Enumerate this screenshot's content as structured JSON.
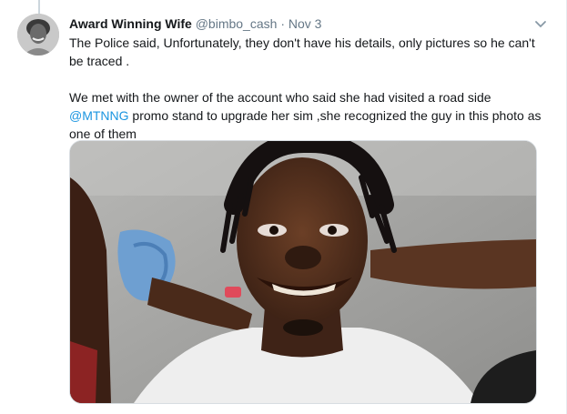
{
  "tweet": {
    "display_name": "Award Winning Wife",
    "handle": "@bimbo_cash",
    "separator": "·",
    "date": "Nov 3",
    "line1": "The Police said, Unfortunately, they don't have his details, only pictures so he can't be traced .",
    "line2_before": "We met with the owner of the account who said she had visited a road side ",
    "mention": "@MTNNG",
    "line2_after": " promo stand to upgrade her sim ,she recognized the guy in this photo as one of them"
  },
  "icons": {
    "caret": "chevron-down-icon"
  },
  "colors": {
    "link": "#1b95e0",
    "secondary_text": "#657786",
    "primary_text": "#14171a",
    "thread_line": "#ccd6dd"
  }
}
